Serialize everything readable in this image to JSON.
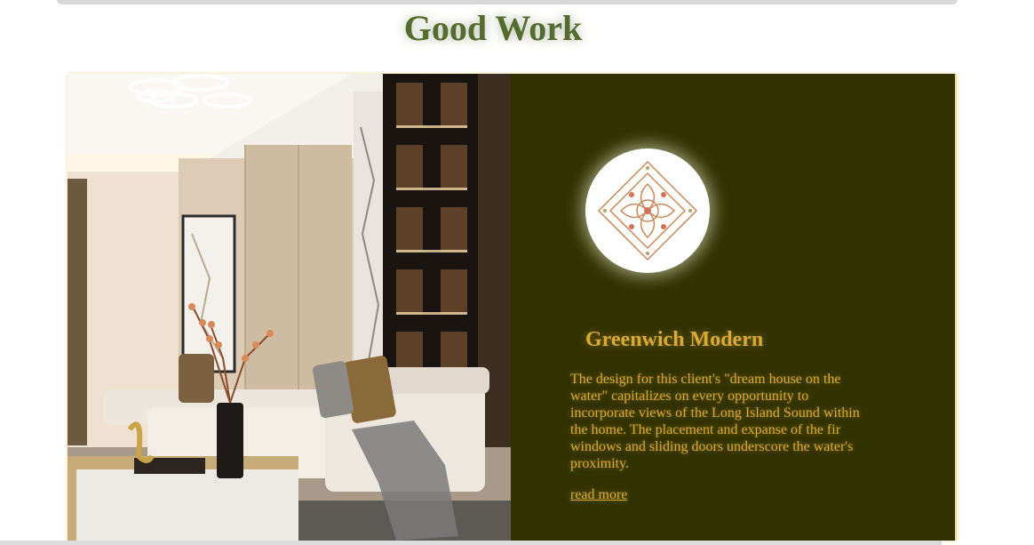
{
  "page": {
    "title": "Good Work"
  },
  "project": {
    "name": "Greenwich Modern",
    "description": "The design for this client's \"dream house on the water\" capitalizes on every opportunity to incorporate views of the Long Island Sound within the home. The placement and expanse of the fir windows and sliding doors underscore the water's proximity.",
    "read_more_label": "read more",
    "image_icon": "living-room-photo",
    "logo_icon": "ornamental-diamond-logo"
  },
  "colors": {
    "title_green": "#556b2f",
    "panel_olive": "#323200",
    "accent_gold": "#d9a93a"
  }
}
